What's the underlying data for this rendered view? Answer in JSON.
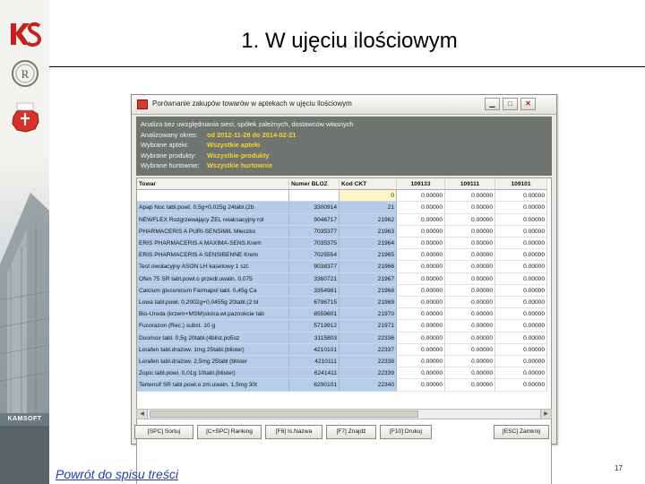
{
  "slide": {
    "title": "1. W ujęciu ilościowym",
    "back_link": "Powrót do spisu treści",
    "page_number": "17",
    "brand_label": "KAMSOFT"
  },
  "window": {
    "title": "Porównanie zakupów towarów w aptekach w ujęciu ilościowym",
    "buttons": {
      "minimize": "▁",
      "maximize": "□",
      "close": "✕"
    }
  },
  "info": {
    "line1": "Analiza bez uwzględniania sieci, spółek zależnych, dostawców własnych",
    "rows": [
      {
        "label": "Analizowany okres:",
        "value": "od 2012-11-28 do 2014-02-21"
      },
      {
        "label": "Wybrane apteki:",
        "value": "Wszystkie apteki"
      },
      {
        "label": "Wybrane produkty:",
        "value": "Wszystkie produkty"
      },
      {
        "label": "Wybrane hurtownie:",
        "value": "Wszystkie hurtownie"
      }
    ]
  },
  "grid": {
    "columns": [
      "Towar",
      "Numer BLOZ",
      "Kod CKT",
      "109133",
      "109111",
      "109101"
    ],
    "rows": [
      [
        "",
        "",
        "0",
        "0.00000",
        "0.00000",
        "0.00000"
      ],
      [
        "Apap Noc tabl.powl. 0,5g+0,025g 24tabl.(2b",
        "3300914",
        "21",
        "0.00000",
        "0.00000",
        "0.00000"
      ],
      [
        "NEWFLEX Rozgrzewający ŻEL relaksacyjny rol",
        "9046717",
        "21962",
        "0.00000",
        "0.00000",
        "0.00000"
      ],
      [
        "PHARMACERIS A PURI-SENSIMIL Mleczko",
        "7035377",
        "21963",
        "0.00000",
        "0.00000",
        "0.00000"
      ],
      [
        "ERIS PHARMACERIS A MAXIMA-SENS.Krem",
        "7035375",
        "21964",
        "0.00000",
        "0.00000",
        "0.00000"
      ],
      [
        "ERIS PHARMACERIS A SENSIBENNE Krem",
        "7025554",
        "21965",
        "0.00000",
        "0.00000",
        "0.00000"
      ],
      [
        "Test owulacyjny ASON LH kasetowy 1 szt.",
        "9038377",
        "21966",
        "0.00000",
        "0.00000",
        "0.00000"
      ],
      [
        "Ofen 75 SR tabl.powl.o przedł.uwaln. 0,075",
        "3360721",
        "21967",
        "0.00000",
        "0.00000",
        "0.00000"
      ],
      [
        "Calcium gluconicum Farmapol tabl. 0,45g Ca",
        "3354981",
        "21968",
        "0.00000",
        "0.00000",
        "0.00000"
      ],
      [
        "Lowa tabl.powl. 0,2002g+0,0455g 20tabl.(2 bl",
        "6786715",
        "21969",
        "0.00000",
        "0.00000",
        "0.00000"
      ],
      [
        "Bio-Uroda (krzem+MSM)skóra,wł.paznokcie tab",
        "8559601",
        "21970",
        "0.00000",
        "0.00000",
        "0.00000"
      ],
      [
        "Fucorazon (Rec.) subst. 10 g",
        "5719912",
        "21971",
        "0.00000",
        "0.00000",
        "0.00000"
      ],
      [
        "Duomox tabl. 0,5g 20tabl.(4blist.po5sz",
        "3115803",
        "22336",
        "0.00000",
        "0.00000",
        "0.00000"
      ],
      [
        "Lorafen tabl.drażow. 1mg 25tabl.(blister)",
        "4210101",
        "22337",
        "0.00000",
        "0.00000",
        "0.00000"
      ],
      [
        "Lorafen tabl.drażow. 2,5mg 25tabl (blister",
        "4210111",
        "22338",
        "0.00000",
        "0.00000",
        "0.00000"
      ],
      [
        "Zopic tabl.powl. 0,01g 10tabl.(blister)",
        "6241411",
        "22339",
        "0.00000",
        "0.00000",
        "0.00000"
      ],
      [
        "Tertensif SR tabl.powl.o zm.uwaln. 1,5mg 30t",
        "6290101",
        "22340",
        "0.00000",
        "0.00000",
        "0.00000"
      ]
    ]
  },
  "footer": {
    "buttons": [
      "[SPC] Sortuj",
      "[C+SPC] Ranking",
      "[F6] Is.Nazwa",
      "[F7] Znajdź",
      "[F10] Drukuj",
      "[ESC] Zamknij"
    ]
  },
  "colors": {
    "info_panel_bg": "#6f7470",
    "info_value": "#f5d42a",
    "highlight_cols": "#b5cde8",
    "back_link": "#1f3fa8"
  },
  "icons": {
    "brand": "ks-logo-icon",
    "registered": "registered-mark-icon",
    "award": "poland-map-icon",
    "app": "app-icon"
  }
}
